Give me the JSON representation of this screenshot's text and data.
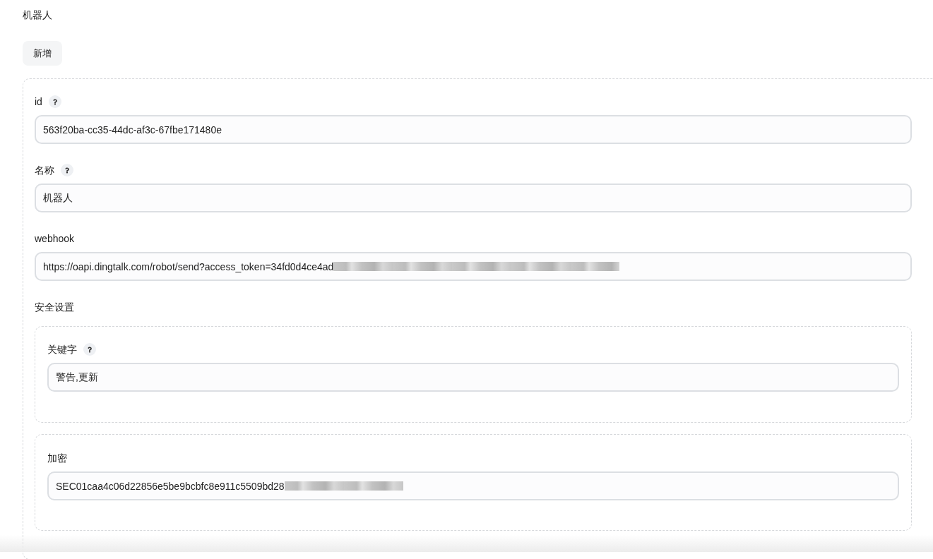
{
  "page": {
    "title": "机器人"
  },
  "add_button": {
    "label": "新增"
  },
  "robot_form": {
    "fields": [
      {
        "label": "id",
        "help": true,
        "value": "563f20ba-cc35-44dc-af3c-67fbe171480e",
        "redacted": false
      },
      {
        "label": "名称",
        "help": true,
        "value": "机器人",
        "redacted": false
      },
      {
        "label": "webhook",
        "help": false,
        "value": "https://oapi.dingtalk.com/robot/send?access_token=34fd0d4ce4ad",
        "redacted": true
      }
    ],
    "security": {
      "label": "安全设置",
      "groups": [
        {
          "label": "关键字",
          "help": true,
          "value": "警告,更新",
          "redacted": false
        },
        {
          "label": "加密",
          "help": false,
          "value": "SEC01caa4c06d22856e5be9bcbfc8e911c5509bd28",
          "redacted": true
        }
      ]
    }
  }
}
